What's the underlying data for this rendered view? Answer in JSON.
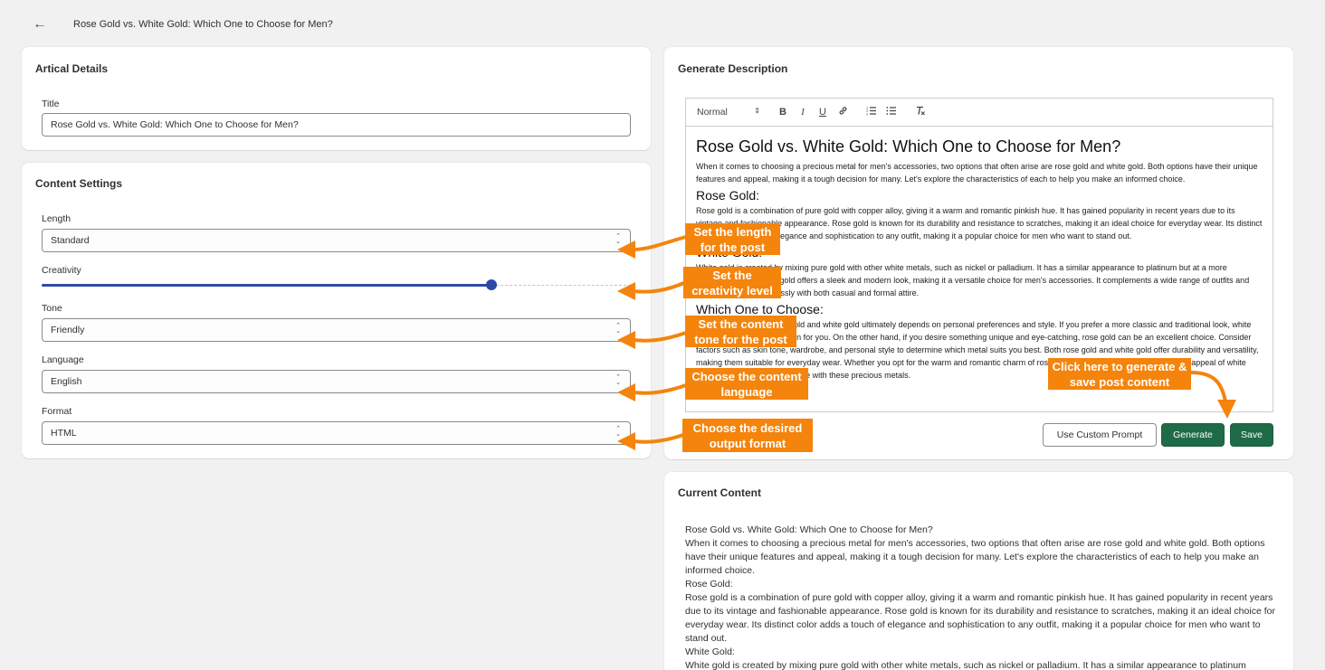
{
  "header": {
    "back_icon": "arrow-left-icon",
    "title": "Rose Gold vs. White Gold: Which One to Choose for Men?"
  },
  "article_details": {
    "heading": "Artical Details",
    "title_label": "Title",
    "title_value": "Rose Gold vs. White Gold: Which One to Choose for Men?"
  },
  "content_settings": {
    "heading": "Content Settings",
    "length_label": "Length",
    "length_value": "Standard",
    "creativity_label": "Creativity",
    "creativity_value": 0.763,
    "tone_label": "Tone",
    "tone_value": "Friendly",
    "language_label": "Language",
    "language_value": "English",
    "format_label": "Format",
    "format_value": "HTML"
  },
  "generate": {
    "heading": "Generate Description",
    "toolbar": {
      "style_select": "Normal",
      "bold": "B",
      "italic": "I",
      "underline": "U",
      "link_icon": "link-icon",
      "ordered_list_icon": "ordered-list-icon",
      "bullet_list_icon": "bullet-list-icon",
      "clear_format_icon": "clear-format-icon"
    },
    "editor": {
      "h1": "Rose Gold vs. White Gold: Which One to Choose for Men?",
      "p1": "When it comes to choosing a precious metal for men's accessories, two options that often arise are rose gold and white gold. Both options have their unique features and appeal, making it a tough decision for many. Let's explore the characteristics of each to help you make an informed choice.",
      "h2a": "Rose Gold:",
      "p2": "Rose gold is a combination of pure gold with copper alloy, giving it a warm and romantic pinkish hue. It has gained popularity in recent years due to its vintage and fashionable appearance. Rose gold is known for its durability and resistance to scratches, making it an ideal choice for everyday wear. Its distinct color adds a touch of elegance and sophistication to any outfit, making it a popular choice for men who want to stand out.",
      "h2b": "White Gold:",
      "p3": "White gold is created by mixing pure gold with other white metals, such as nickel or palladium. It has a similar appearance to platinum but at a more affordable price. White gold offers a sleek and modern look, making it a versatile choice for men's accessories. It complements a wide range of outfits and styles, blending seamlessly with both casual and formal attire.",
      "h2c": "Which One to Choose:",
      "p4": "The choice between rose gold and white gold ultimately depends on personal preferences and style. If you prefer a more classic and traditional look, white gold might be the right option for you. On the other hand, if you desire something unique and eye-catching, rose gold can be an excellent choice. Consider factors such as skin tone, wardrobe, and personal style to determine which metal suits you best. Both rose gold and white gold offer durability and versatility, making them suitable for everyday wear. Whether you opt for the warm and romantic charm of rose gold or the modern and sophisticated appeal of white gold, you can elevate your style with these precious metals."
    },
    "custom_prompt_label": "Use Custom Prompt",
    "generate_label": "Generate",
    "save_label": "Save"
  },
  "current_content": {
    "heading": "Current Content",
    "line1": "Rose Gold vs. White Gold: Which One to Choose for Men?",
    "line2": "When it comes to choosing a precious metal for men's accessories, two options that often arise are rose gold and white gold. Both options have their unique features and appeal, making it a tough decision for many. Let's explore the characteristics of each to help you make an informed choice.",
    "line3": "Rose Gold:",
    "line4": "Rose gold is a combination of pure gold with copper alloy, giving it a warm and romantic pinkish hue. It has gained popularity in recent years due to its vintage and fashionable appearance. Rose gold is known for its durability and resistance to scratches, making it an ideal choice for everyday wear. Its distinct color adds a touch of elegance and sophistication to any outfit, making it a popular choice for men who want to stand out.",
    "line5": "White Gold:",
    "line6": "White gold is created by mixing pure gold with other white metals, such as nickel or palladium. It has a similar appearance to platinum"
  },
  "callouts": {
    "length": "Set the length for the post",
    "creativity": "Set the creativity level",
    "tone": "Set the content tone for the post",
    "language": "Choose the content language",
    "format": "Choose the desired output format",
    "generate_save": "Click here to generate & save post content"
  },
  "colors": {
    "accent": "#2e4aa8",
    "primary_button": "#1f6b48",
    "callout": "#f4840c",
    "background": "#f1f1f1"
  }
}
